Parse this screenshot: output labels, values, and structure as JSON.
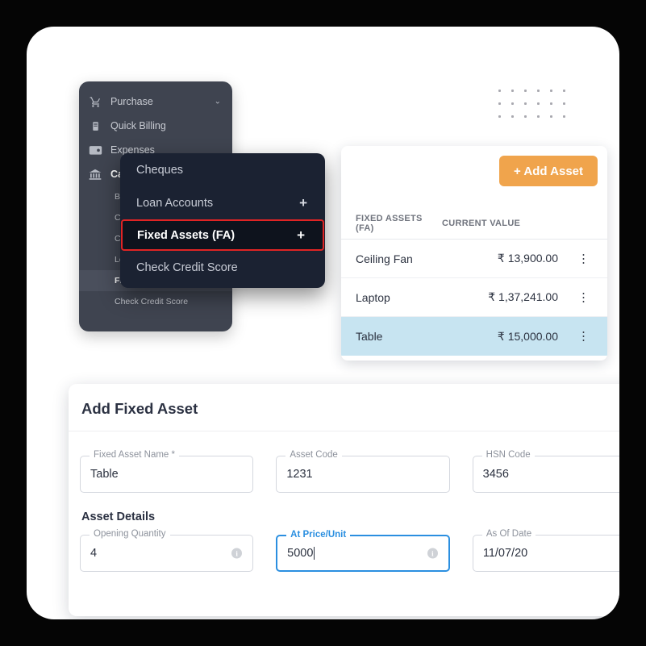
{
  "sidebar": {
    "main_items": [
      {
        "label": "Purchase",
        "icon": "shopping-cart-icon",
        "chevron": "⌄",
        "active": false
      },
      {
        "label": "Quick Billing",
        "icon": "printer-icon",
        "active": false
      },
      {
        "label": "Expenses",
        "icon": "wallet-icon",
        "active": false
      },
      {
        "label": "Cash & Bank",
        "icon": "bank-icon",
        "active": true
      }
    ],
    "sub_items": [
      {
        "label": "Bank Accounts",
        "selected": false,
        "plus": ""
      },
      {
        "label": "Cash In Hand",
        "selected": false,
        "plus": ""
      },
      {
        "label": "Cheques",
        "selected": false,
        "plus": ""
      },
      {
        "label": "Loan Accounts",
        "selected": false,
        "plus": ""
      },
      {
        "label": "Fixed Assets (FA)",
        "selected": true,
        "plus": "+"
      },
      {
        "label": "Check Credit Score",
        "selected": false,
        "plus": ""
      }
    ]
  },
  "flyout": {
    "items": [
      {
        "label": "Cheques",
        "plus": "",
        "highlighted": false
      },
      {
        "label": "Loan Accounts",
        "plus": "+",
        "highlighted": false
      },
      {
        "label": "Fixed Assets (FA)",
        "plus": "+",
        "highlighted": true
      },
      {
        "label": "Check Credit Score",
        "plus": "",
        "highlighted": false
      }
    ],
    "highlight_border_color": "#e02424"
  },
  "assets_table": {
    "add_button_label": "+ Add Asset",
    "add_button_color": "#f0a44c",
    "columns": [
      "FIXED ASSETS (FA)",
      "CURRENT VALUE"
    ],
    "rows": [
      {
        "name": "Ceiling Fan",
        "value": "₹ 13,900.00",
        "menu": "⋮",
        "selected": false
      },
      {
        "name": "Laptop",
        "value": "₹ 1,37,241.00",
        "menu": "⋮",
        "selected": false
      },
      {
        "name": "Table",
        "value": "₹ 15,000.00",
        "menu": "⋮",
        "selected": true
      }
    ],
    "selected_row_color": "#c7e4f1"
  },
  "form": {
    "title": "Add Fixed Asset",
    "section_label": "Asset Details",
    "fields": [
      {
        "label": "Fixed Asset Name *",
        "value": "Table",
        "focused": false,
        "info": false
      },
      {
        "label": "Asset Code",
        "value": "1231",
        "focused": false,
        "info": false
      },
      {
        "label": "HSN Code",
        "value": "3456",
        "focused": false,
        "info": false
      },
      {
        "label": "Opening Quantity",
        "value": "4",
        "focused": false,
        "info": true
      },
      {
        "label": "At Price/Unit",
        "value": "5000",
        "focused": true,
        "info": true
      },
      {
        "label": "As Of Date",
        "value": "11/07/20",
        "focused": false,
        "info": false
      }
    ],
    "focus_color": "#2b8fe0",
    "info_glyph": "i"
  }
}
